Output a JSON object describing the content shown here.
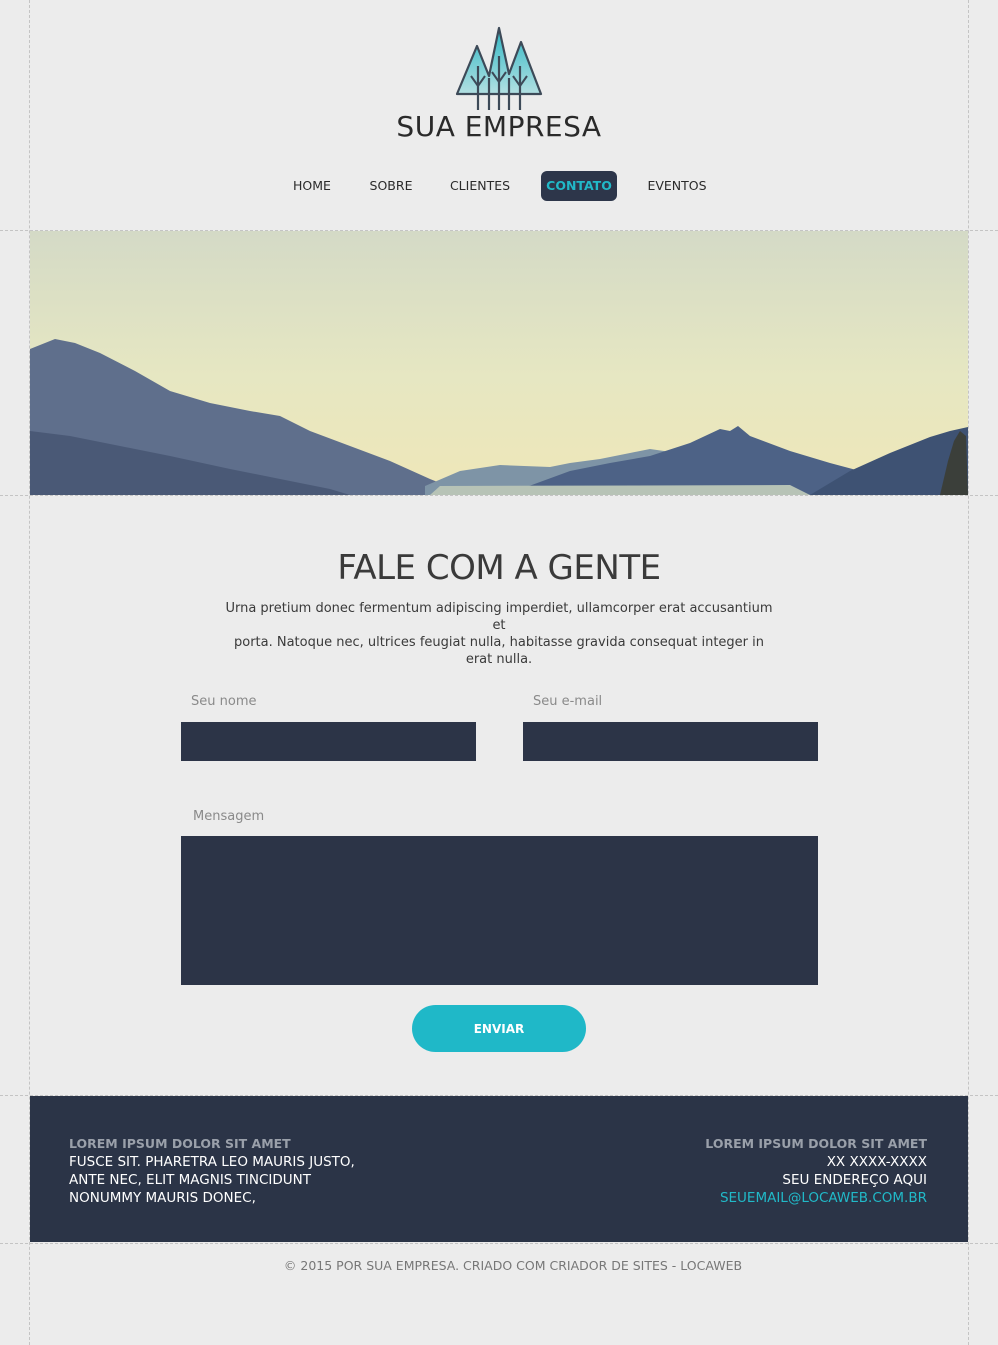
{
  "brand": {
    "name": "SUA EMPRESA",
    "logo_icon": "mountain-trees-logo-icon"
  },
  "nav": {
    "items": [
      {
        "label": "HOME",
        "active": false
      },
      {
        "label": "SOBRE",
        "active": false
      },
      {
        "label": "CLIENTES",
        "active": false
      },
      {
        "label": "CONTATO",
        "active": true
      },
      {
        "label": "EVENTOS",
        "active": false
      }
    ]
  },
  "hero": {
    "image": "mountain-landscape-banner"
  },
  "contact": {
    "title": "FALE COM A GENTE",
    "intro_line1": "Urna pretium donec fermentum adipiscing imperdiet, ullamcorper erat accusantium et",
    "intro_line2": "porta. Natoque nec, ultrices feugiat nulla, habitasse gravida consequat integer in erat nulla.",
    "name_label": "Seu nome",
    "name_value": "",
    "email_label": "Seu e-mail",
    "email_value": "",
    "message_label": "Mensagem",
    "message_value": "",
    "submit_label": "ENVIAR"
  },
  "footer": {
    "left": {
      "heading": "LOREM IPSUM DOLOR SIT AMET",
      "line1": "FUSCE SIT. PHARETRA LEO MAURIS JUSTO,",
      "line2": "ANTE NEC, ELIT MAGNIS TINCIDUNT",
      "line3": "NONUMMY MAURIS DONEC,"
    },
    "right": {
      "heading": "LOREM IPSUM DOLOR SIT AMET",
      "phone": "XX XXXX-XXXX",
      "address": "SEU ENDEREÇO AQUI",
      "email": "SEUEMAIL@LOCAWEB.COM.BR"
    }
  },
  "copyright": "© 2015 POR SUA EMPRESA. CRIADO COM CRIADOR DE SITES - LOCAWEB",
  "colors": {
    "background": "#ececec",
    "navy": "#2c3447",
    "accent": "#1fb8c8",
    "text_dark": "#2a2a2a"
  }
}
